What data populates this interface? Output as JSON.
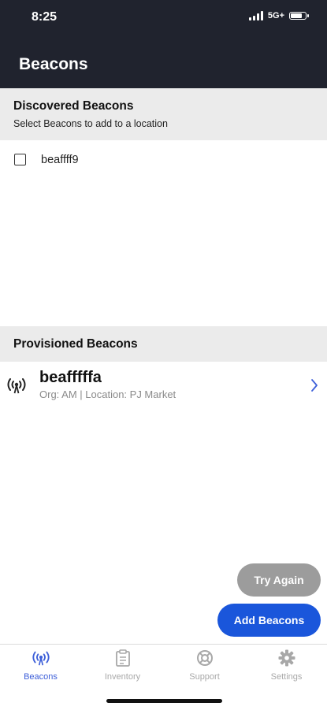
{
  "status_bar": {
    "time": "8:25",
    "network": "5G+",
    "signal_bars": 4,
    "battery_level": 0.8
  },
  "header": {
    "title": "Beacons"
  },
  "discovered": {
    "title": "Discovered Beacons",
    "subtitle": "Select Beacons to add to a location",
    "items": [
      {
        "label": "beaffff9",
        "checked": false
      }
    ]
  },
  "provisioned": {
    "title": "Provisioned Beacons",
    "items": [
      {
        "name": "beafffffa",
        "detail": "Org: AM | Location: PJ Market",
        "icon": "beacon-broadcast-icon"
      }
    ]
  },
  "actions": {
    "try_again": "Try Again",
    "add_beacons": "Add Beacons"
  },
  "tabs": [
    {
      "label": "Beacons",
      "icon": "beacon-broadcast-icon",
      "active": true
    },
    {
      "label": "Inventory",
      "icon": "clipboard-icon",
      "active": false
    },
    {
      "label": "Support",
      "icon": "lifebuoy-icon",
      "active": false
    },
    {
      "label": "Settings",
      "icon": "gear-icon",
      "active": false
    }
  ],
  "colors": {
    "header_bg": "#20232e",
    "section_bg": "#ebebeb",
    "primary": "#1a56db",
    "disabled": "#9c9c9c",
    "tab_active": "#3d5fd9",
    "tab_inactive": "#a8a8a8"
  }
}
